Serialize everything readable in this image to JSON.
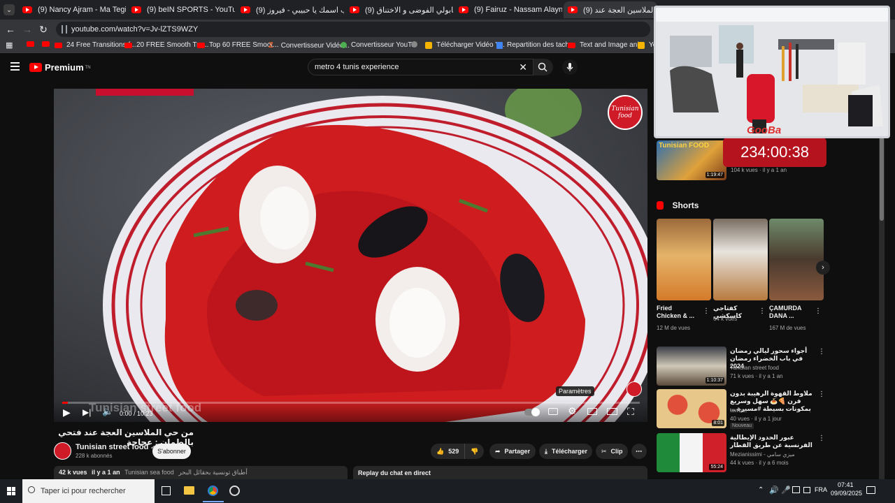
{
  "browser": {
    "tabs": [
      {
        "title": "(9) Nancy Ajram - Ma Tegi Here",
        "active": false
      },
      {
        "title": "(9) beIN SPORTS - YouTube",
        "active": false
      },
      {
        "title": "(9) يكتب اسمك يا حبيبي - فيروز |",
        "active": false
      },
      {
        "title": "(9) شاهد نابولي الفوضى و الاختناق",
        "active": false
      },
      {
        "title": "(9) Fairuz - Nassam Alayna El H",
        "active": false
      },
      {
        "title": "من حي الملاسين العجة عند (9)",
        "active": true
      }
    ],
    "url": "youtube.com/watch?v=Jv-lZTS9WZY",
    "bookmarks": [
      "24 Free Transitions f...",
      "20 FREE Smooth Tra...",
      "Top 60 FREE Smoot...",
      "Convertisseur Vidéo...",
      "Convertisseur YouT...",
      "Télécharger Vidéo Y...",
      "Repartition des tach...",
      "Text and Image ani...",
      "Yo"
    ]
  },
  "youtube": {
    "logo": "Premium",
    "logo_sup": "TN",
    "search_query": "metro 4 tunis experience"
  },
  "player": {
    "current_time": "0:00",
    "duration": "10:23",
    "time_display": "0:00 / 10:23",
    "settings_tooltip": "Paramètres",
    "watermark": "Tunisian street food",
    "logo_text": "Tunisian food",
    "progress": 0.01
  },
  "video": {
    "title": "من حي الملاسين العجة عند فتحي بالطمان : عجاجة",
    "channel": "Tunisian street food",
    "subscribers": "228 k abonnés",
    "subscribe_label": "S'abonner",
    "likes": "529",
    "share_label": "Partager",
    "download_label": "Télécharger",
    "clip_label": "Clip",
    "views": "42 k vues",
    "age": "il y a 1 an",
    "desc_snippet": "Tunisian sea food",
    "desc_arabic": "أطباق تونسية بحقائل البحر",
    "chat_label": "Replay du chat en direct"
  },
  "sidebar": {
    "top_item": {
      "duration": "1:19:47",
      "meta": "104 k vues · il y a 1 an",
      "thumb_label": "Tunisian FOOD"
    },
    "timer": "234:00:38",
    "webcam_label": "GooBa",
    "shorts_heading": "Shorts",
    "shorts": [
      {
        "title": "Fried Chicken & ...",
        "views": "12 M de vues"
      },
      {
        "title": "كفتاجي كاسكشي",
        "views": "64 k vues"
      },
      {
        "title": "ÇAMURDA DANA ...",
        "views": "167 M de vues"
      }
    ],
    "videos": [
      {
        "title": "أجواء سحور ليالي رمضان في باب الخضراء رمضان 2024",
        "channel": "Tunisian street food",
        "meta": "71 k vues · il y a 1 an",
        "duration": "1:10:37",
        "badge": ""
      },
      {
        "title": "ملاوط القهوة الرهيبة بدون فرن 🍕🍝 سهل وسريع بمكونات بسيطة #مسيرة ...",
        "channel": "tawba",
        "meta": "40 vues · il y a 1 jour",
        "duration": "8:01",
        "badge": "Nouveau"
      },
      {
        "title": "عبور الحدود الإيطالية الفرنسية عن طريق القطار",
        "channel": "Mezianissimi - ميزي سامي",
        "meta": "44 k vues · il y a 6 mois",
        "duration": "55:24",
        "badge": ""
      }
    ]
  },
  "taskbar": {
    "search_placeholder": "Taper ici pour rechercher",
    "language": "FRA",
    "time": "07:41",
    "date": "09/09/2025"
  },
  "colors": {
    "youtube_red": "#ff0000",
    "accent_red": "#cf1b28",
    "background": "#0f0f0f"
  }
}
